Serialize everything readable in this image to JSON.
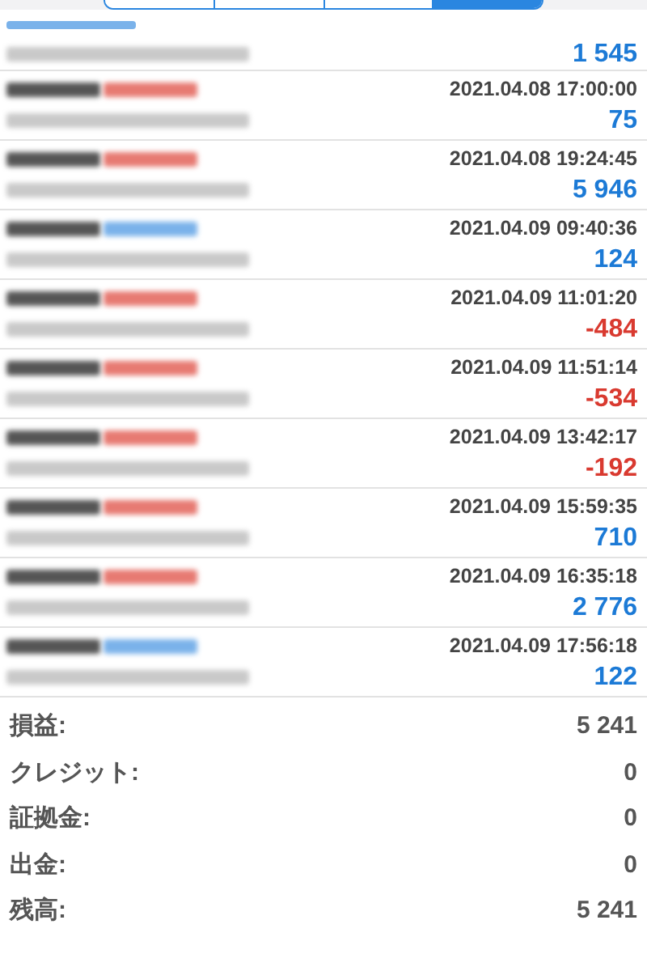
{
  "tabs": [
    {
      "selected": false
    },
    {
      "selected": false
    },
    {
      "selected": false
    },
    {
      "selected": true
    }
  ],
  "trades": [
    {
      "color": "#7ab2ea",
      "partial": true,
      "profit": "1 545",
      "loss": false
    },
    {
      "color": "#e77a72",
      "date": "2021.04.08 17:00:00",
      "profit": "75",
      "loss": false
    },
    {
      "color": "#e77a72",
      "date": "2021.04.08 19:24:45",
      "profit": "5 946",
      "loss": false
    },
    {
      "color": "#7ab2ea",
      "date": "2021.04.09 09:40:36",
      "profit": "124",
      "loss": false
    },
    {
      "color": "#e77a72",
      "date": "2021.04.09 11:01:20",
      "profit": "-484",
      "loss": true
    },
    {
      "color": "#e77a72",
      "date": "2021.04.09 11:51:14",
      "profit": "-534",
      "loss": true
    },
    {
      "color": "#e77a72",
      "date": "2021.04.09 13:42:17",
      "profit": "-192",
      "loss": true
    },
    {
      "color": "#e77a72",
      "date": "2021.04.09 15:59:35",
      "profit": "710",
      "loss": false
    },
    {
      "color": "#e77a72",
      "date": "2021.04.09 16:35:18",
      "profit": "2 776",
      "loss": false
    },
    {
      "color": "#7ab2ea",
      "date": "2021.04.09 17:56:18",
      "profit": "122",
      "loss": false
    }
  ],
  "summary": [
    {
      "label": "損益:",
      "value": "5 241"
    },
    {
      "label": "クレジット:",
      "value": "0"
    },
    {
      "label": "証拠金:",
      "value": "0"
    },
    {
      "label": "出金:",
      "value": "0"
    },
    {
      "label": "残高:",
      "value": "5 241"
    }
  ]
}
